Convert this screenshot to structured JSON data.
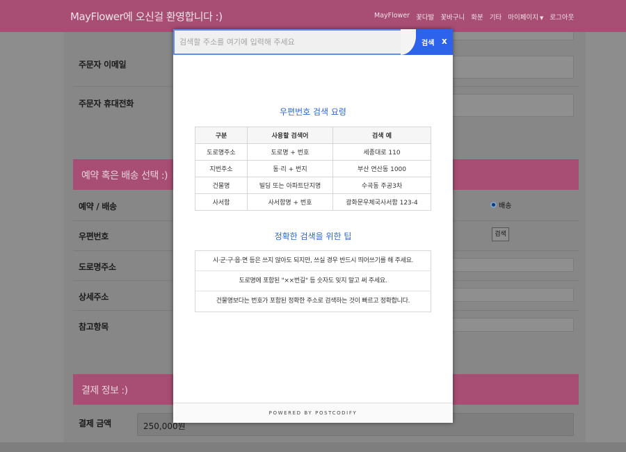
{
  "navbar": {
    "brand": "MayFlower에 오신걸 환영합니다 :)",
    "menu": [
      "MayFlower",
      "꽃다발",
      "꽃바구니",
      "화분",
      "기타",
      "마이페이지",
      "로그아웃"
    ]
  },
  "form": {
    "orderer_email_label": "주문자 이메일",
    "orderer_phone_label": "주문자 휴대전화",
    "delivery_section_title": "예약 혹은 배송 선택 :)",
    "reservation_label": "예약 / 배송",
    "delivery_option": "배송",
    "postcode_label": "우편번호",
    "postcode_search_button": "검색",
    "road_address_label": "도로명주소",
    "detail_address_label": "상세주소",
    "reference_label": "참고항목",
    "payment_section_title": "결제 정보 :)",
    "payment_amount_label": "결제 금액",
    "payment_amount_value": "250,000원"
  },
  "modal": {
    "search_placeholder": "검색할 주소를 여기에 입력해 주세요",
    "search_button": "검색",
    "close_button": "x",
    "guide_title": "우편번호 검색 요령",
    "table_headers": [
      "구분",
      "사용할 검색어",
      "검색 예"
    ],
    "table_rows": [
      [
        "도로명주소",
        "도로명 + 번호",
        "세종대로 110"
      ],
      [
        "지번주소",
        "동·리 + 번지",
        "부산 연산동 1000"
      ],
      [
        "건물명",
        "빌딩 또는 아파트단지명",
        "수곡동 주공3차"
      ],
      [
        "사서함",
        "사서함명 + 번호",
        "광화문우체국사서함 123-4"
      ]
    ],
    "tips_title": "정확한 검색을 위한 팁",
    "tips": [
      "시·군·구·읍·면 등은 쓰지 않아도 되지만, 쓰실 경우 반드시 띄어쓰기를 해 주세요.",
      "도로명에 포함된 \"××번길\" 등 숫자도 잊지 말고 써 주세요.",
      "건물명보다는 번호가 포함된 정확한 주소로 검색하는 것이 빠르고 정확합니다."
    ],
    "footer": "POWERED BY POSTCODIFY"
  },
  "colors": {
    "brand_pink": "#a84d73",
    "modal_blue": "#2d63ec",
    "title_blue": "#2a67d6"
  }
}
